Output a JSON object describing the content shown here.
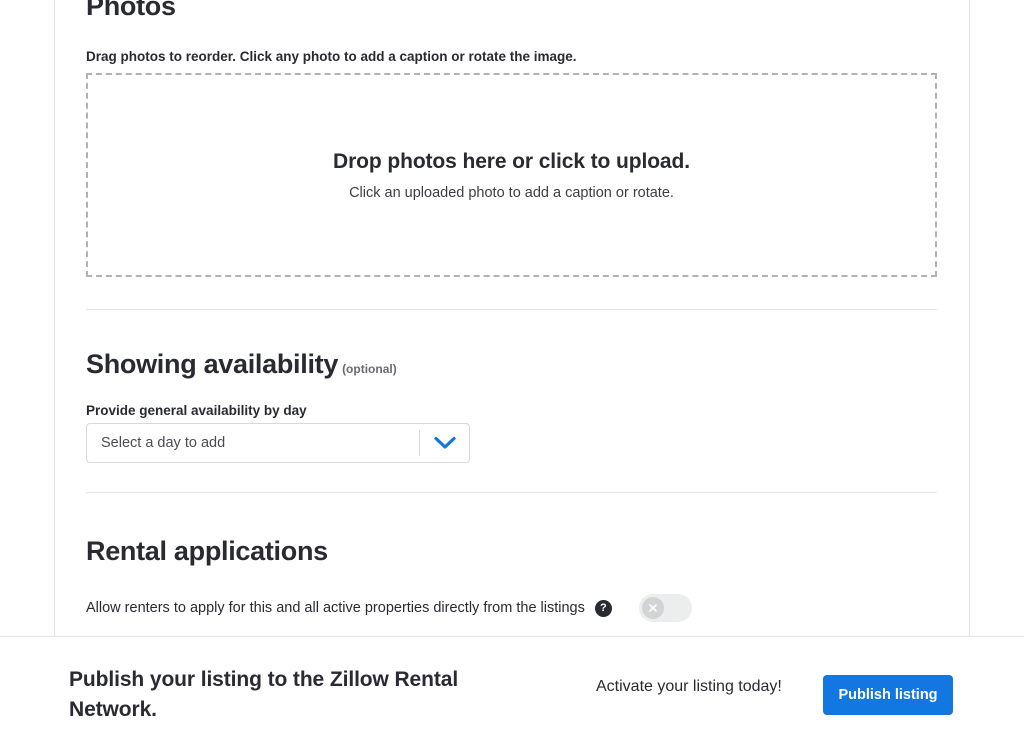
{
  "colors": {
    "accent_blue": "#1277e1",
    "text_primary": "#2a2a33",
    "text_muted": "#6a6a73",
    "border": "#e4e4e8",
    "input_border": "#d7d7dc",
    "dashed_border": "#b1b1b8",
    "toggle_track_off": "#eceded",
    "toggle_knob_off": "#d2d3d6"
  },
  "photos": {
    "heading": "Photos",
    "instructions": "Drag photos to reorder. Click any photo to add a caption or rotate the image.",
    "dropzone": {
      "title": "Drop photos here or click to upload.",
      "subtitle": "Click an uploaded photo to add a caption or rotate."
    }
  },
  "showing_availability": {
    "heading": "Showing availability",
    "optional_tag": "(optional)",
    "field_label": "Provide general availability by day",
    "select": {
      "placeholder": "Select a day to add",
      "value": "Select a day to add",
      "chevron_icon": "chevron-down-icon"
    }
  },
  "rental_applications": {
    "heading": "Rental applications",
    "allow_label": "Allow renters to apply for this and all active properties directly from the listings",
    "help_icon": "help-icon",
    "help_glyph": "?",
    "toggle": {
      "state": "off",
      "knob_icon": "close-x-icon"
    }
  },
  "footer": {
    "title": "Publish your listing to the Zillow Rental Network.",
    "cta_text": "Activate your listing today!",
    "publish_label": "Publish listing"
  }
}
